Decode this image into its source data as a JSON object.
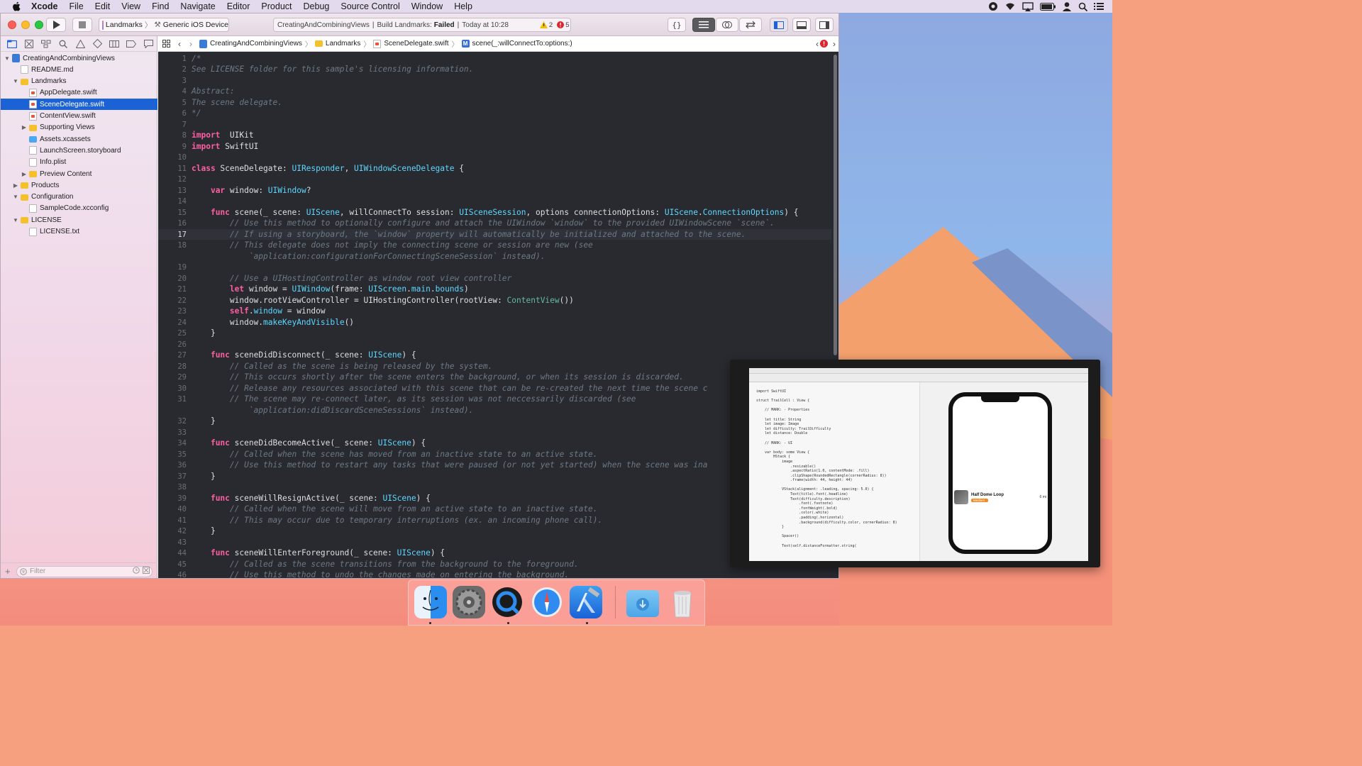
{
  "menubar": {
    "app": "Xcode",
    "items": [
      "File",
      "Edit",
      "View",
      "Find",
      "Navigate",
      "Editor",
      "Product",
      "Debug",
      "Source Control",
      "Window",
      "Help"
    ],
    "status_icons": [
      "creative-cloud-icon",
      "wifi-icon",
      "airplay-icon",
      "battery-icon",
      "user-icon",
      "spotlight-icon",
      "notification-center-icon"
    ]
  },
  "toolbar": {
    "scheme_target": "Landmarks",
    "scheme_device": "Generic iOS Device",
    "activity_project": "CreatingAndCombiningViews",
    "activity_status_prefix": "Build Landmarks:",
    "activity_status": "Failed",
    "activity_time": "Today at 10:28",
    "warnings": "2",
    "errors": "5"
  },
  "navigator": {
    "filter_placeholder": "Filter",
    "tree": [
      {
        "label": "CreatingAndCombiningViews",
        "kind": "proj",
        "depth": 0,
        "disclosure": "open"
      },
      {
        "label": "README.md",
        "kind": "file",
        "depth": 1,
        "disclosure": ""
      },
      {
        "label": "Landmarks",
        "kind": "folder",
        "depth": 1,
        "disclosure": "open"
      },
      {
        "label": "AppDelegate.swift",
        "kind": "swift",
        "depth": 2,
        "disclosure": ""
      },
      {
        "label": "SceneDelegate.swift",
        "kind": "swift",
        "depth": 2,
        "disclosure": "",
        "selected": true
      },
      {
        "label": "ContentView.swift",
        "kind": "swift",
        "depth": 2,
        "disclosure": ""
      },
      {
        "label": "Supporting Views",
        "kind": "folder",
        "depth": 2,
        "disclosure": "closed"
      },
      {
        "label": "Assets.xcassets",
        "kind": "assets",
        "depth": 2,
        "disclosure": ""
      },
      {
        "label": "LaunchScreen.storyboard",
        "kind": "file",
        "depth": 2,
        "disclosure": ""
      },
      {
        "label": "Info.plist",
        "kind": "file",
        "depth": 2,
        "disclosure": ""
      },
      {
        "label": "Preview Content",
        "kind": "folder",
        "depth": 2,
        "disclosure": "closed"
      },
      {
        "label": "Products",
        "kind": "folder",
        "depth": 1,
        "disclosure": "closed"
      },
      {
        "label": "Configuration",
        "kind": "folder",
        "depth": 1,
        "disclosure": "open"
      },
      {
        "label": "SampleCode.xcconfig",
        "kind": "file",
        "depth": 2,
        "disclosure": ""
      },
      {
        "label": "LICENSE",
        "kind": "folder",
        "depth": 1,
        "disclosure": "open"
      },
      {
        "label": "LICENSE.txt",
        "kind": "file",
        "depth": 2,
        "disclosure": ""
      }
    ]
  },
  "jumpbar": {
    "segments": [
      "CreatingAndCombiningViews",
      "Landmarks",
      "SceneDelegate.swift",
      "scene(_:willConnectTo:options:)"
    ]
  },
  "editor": {
    "current_line": "17",
    "lines": [
      {
        "n": "1",
        "tokens": [
          [
            "c",
            "/*"
          ]
        ]
      },
      {
        "n": "2",
        "tokens": [
          [
            "c",
            "See LICENSE folder for this sample's licensing information."
          ]
        ]
      },
      {
        "n": "3",
        "tokens": []
      },
      {
        "n": "4",
        "tokens": [
          [
            "c",
            "Abstract:"
          ]
        ]
      },
      {
        "n": "5",
        "tokens": [
          [
            "c",
            "The scene delegate."
          ]
        ]
      },
      {
        "n": "6",
        "tokens": [
          [
            "c",
            "*/"
          ]
        ]
      },
      {
        "n": "7",
        "tokens": []
      },
      {
        "n": "8",
        "tokens": [
          [
            "k",
            "import"
          ],
          [
            "",
            "  UIKit"
          ]
        ]
      },
      {
        "n": "9",
        "tokens": [
          [
            "k",
            "import"
          ],
          [
            "",
            " SwiftUI"
          ]
        ]
      },
      {
        "n": "10",
        "tokens": []
      },
      {
        "n": "11",
        "tokens": [
          [
            "k",
            "class"
          ],
          [
            "",
            " SceneDelegate: "
          ],
          [
            "t",
            "UIResponder"
          ],
          [
            "",
            ", "
          ],
          [
            "t",
            "UIWindowSceneDelegate"
          ],
          [
            "",
            " {"
          ]
        ]
      },
      {
        "n": "12",
        "tokens": []
      },
      {
        "n": "13",
        "tokens": [
          [
            "",
            "    "
          ],
          [
            "k",
            "var"
          ],
          [
            "",
            " window: "
          ],
          [
            "t",
            "UIWindow"
          ],
          [
            "",
            "?"
          ]
        ]
      },
      {
        "n": "14",
        "tokens": []
      },
      {
        "n": "15",
        "tokens": [
          [
            "",
            "    "
          ],
          [
            "k",
            "func"
          ],
          [
            "",
            " scene(_ scene: "
          ],
          [
            "t",
            "UIScene"
          ],
          [
            "",
            ", willConnectTo session: "
          ],
          [
            "t",
            "UISceneSession"
          ],
          [
            "",
            ", options connectionOptions: "
          ],
          [
            "t",
            "UIScene"
          ],
          [
            "",
            "."
          ],
          [
            "t",
            "ConnectionOptions"
          ],
          [
            "",
            ") {"
          ]
        ]
      },
      {
        "n": "16",
        "tokens": [
          [
            "",
            "        "
          ],
          [
            "c",
            "// Use this method to optionally configure and attach the UIWindow `window` to the provided UIWindowScene `scene`."
          ]
        ]
      },
      {
        "n": "17",
        "tokens": [
          [
            "",
            "        "
          ],
          [
            "c",
            "// If using a storyboard, the `window` property will automatically be initialized and attached to the scene."
          ]
        ]
      },
      {
        "n": "18",
        "tokens": [
          [
            "",
            "        "
          ],
          [
            "c",
            "// This delegate does not imply the connecting scene or session are new (see"
          ]
        ]
      },
      {
        "n": "",
        "tokens": [
          [
            "",
            "            "
          ],
          [
            "c",
            "`application:configurationForConnectingSceneSession` instead)."
          ]
        ]
      },
      {
        "n": "19",
        "tokens": []
      },
      {
        "n": "20",
        "tokens": [
          [
            "",
            "        "
          ],
          [
            "c",
            "// Use a UIHostingController as window root view controller"
          ]
        ]
      },
      {
        "n": "21",
        "tokens": [
          [
            "",
            "        "
          ],
          [
            "k",
            "let"
          ],
          [
            "",
            " window = "
          ],
          [
            "t",
            "UIWindow"
          ],
          [
            "",
            "(frame: "
          ],
          [
            "t",
            "UIScreen"
          ],
          [
            "",
            "."
          ],
          [
            "t",
            "main"
          ],
          [
            "",
            "."
          ],
          [
            "t",
            "bounds"
          ],
          [
            "",
            ")"
          ]
        ]
      },
      {
        "n": "22",
        "tokens": [
          [
            "",
            "        window.rootViewController = UIHostingController(rootView: "
          ],
          [
            "p",
            "ContentView"
          ],
          [
            "",
            "())"
          ]
        ]
      },
      {
        "n": "23",
        "tokens": [
          [
            "",
            "        "
          ],
          [
            "k",
            "self"
          ],
          [
            "",
            "."
          ],
          [
            "t",
            "window"
          ],
          [
            "",
            " = window"
          ]
        ]
      },
      {
        "n": "24",
        "tokens": [
          [
            "",
            "        window."
          ],
          [
            "t",
            "makeKeyAndVisible"
          ],
          [
            "",
            "()"
          ]
        ]
      },
      {
        "n": "25",
        "tokens": [
          [
            "",
            "    }"
          ]
        ]
      },
      {
        "n": "26",
        "tokens": []
      },
      {
        "n": "27",
        "tokens": [
          [
            "",
            "    "
          ],
          [
            "k",
            "func"
          ],
          [
            "",
            " sceneDidDisconnect(_ scene: "
          ],
          [
            "t",
            "UIScene"
          ],
          [
            "",
            ") {"
          ]
        ]
      },
      {
        "n": "28",
        "tokens": [
          [
            "",
            "        "
          ],
          [
            "c",
            "// Called as the scene is being released by the system."
          ]
        ]
      },
      {
        "n": "29",
        "tokens": [
          [
            "",
            "        "
          ],
          [
            "c",
            "// This occurs shortly after the scene enters the background, or when its session is discarded."
          ]
        ]
      },
      {
        "n": "30",
        "tokens": [
          [
            "",
            "        "
          ],
          [
            "c",
            "// Release any resources associated with this scene that can be re-created the next time the scene c"
          ]
        ]
      },
      {
        "n": "31",
        "tokens": [
          [
            "",
            "        "
          ],
          [
            "c",
            "// The scene may re-connect later, as its session was not neccessarily discarded (see"
          ]
        ]
      },
      {
        "n": "",
        "tokens": [
          [
            "",
            "            "
          ],
          [
            "c",
            "`application:didDiscardSceneSessions` instead)."
          ]
        ]
      },
      {
        "n": "32",
        "tokens": [
          [
            "",
            "    }"
          ]
        ]
      },
      {
        "n": "33",
        "tokens": []
      },
      {
        "n": "34",
        "tokens": [
          [
            "",
            "    "
          ],
          [
            "k",
            "func"
          ],
          [
            "",
            " sceneDidBecomeActive(_ scene: "
          ],
          [
            "t",
            "UIScene"
          ],
          [
            "",
            ") {"
          ]
        ]
      },
      {
        "n": "35",
        "tokens": [
          [
            "",
            "        "
          ],
          [
            "c",
            "// Called when the scene has moved from an inactive state to an active state."
          ]
        ]
      },
      {
        "n": "36",
        "tokens": [
          [
            "",
            "        "
          ],
          [
            "c",
            "// Use this method to restart any tasks that were paused (or not yet started) when the scene was ina"
          ]
        ]
      },
      {
        "n": "37",
        "tokens": [
          [
            "",
            "    }"
          ]
        ]
      },
      {
        "n": "38",
        "tokens": []
      },
      {
        "n": "39",
        "tokens": [
          [
            "",
            "    "
          ],
          [
            "k",
            "func"
          ],
          [
            "",
            " sceneWillResignActive(_ scene: "
          ],
          [
            "t",
            "UIScene"
          ],
          [
            "",
            ") {"
          ]
        ]
      },
      {
        "n": "40",
        "tokens": [
          [
            "",
            "        "
          ],
          [
            "c",
            "// Called when the scene will move from an active state to an inactive state."
          ]
        ]
      },
      {
        "n": "41",
        "tokens": [
          [
            "",
            "        "
          ],
          [
            "c",
            "// This may occur due to temporary interruptions (ex. an incoming phone call)."
          ]
        ]
      },
      {
        "n": "42",
        "tokens": [
          [
            "",
            "    }"
          ]
        ]
      },
      {
        "n": "43",
        "tokens": []
      },
      {
        "n": "44",
        "tokens": [
          [
            "",
            "    "
          ],
          [
            "k",
            "func"
          ],
          [
            "",
            " sceneWillEnterForeground(_ scene: "
          ],
          [
            "t",
            "UIScene"
          ],
          [
            "",
            ") {"
          ]
        ]
      },
      {
        "n": "45",
        "tokens": [
          [
            "",
            "        "
          ],
          [
            "c",
            "// Called as the scene transitions from the background to the foreground."
          ]
        ]
      },
      {
        "n": "46",
        "tokens": [
          [
            "",
            "        "
          ],
          [
            "c",
            "// Use this method to undo the changes made on entering the background."
          ]
        ]
      }
    ]
  },
  "pip": {
    "code_lines": [
      "import SwiftUI",
      "",
      "struct TrailCell : View {",
      "",
      "    // MARK: - Properties",
      "",
      "    let title: String",
      "    let image: Image",
      "    let difficulty: TrailDifficulty",
      "    let distance: Double",
      "",
      "    // MARK: - UI",
      "",
      "    var body: some View {",
      "        HStack {",
      "            image",
      "                .resizable()",
      "                .aspectRatio(1.0, contentMode: .fill)",
      "                .clipShape(RoundedRectangle(cornerRadius: 8))",
      "                .frame(width: 44, height: 44)",
      "",
      "            VStack(alignment: .leading, spacing: 5.0) {",
      "                Text(title).font(.headline)",
      "                Text(difficulty.description)",
      "                    .font(.footnote)",
      "                    .fontWeight(.bold)",
      "                    .color(.white)",
      "                    .padding(.horizontal)",
      "                    .background(difficulty.color, cornerRadius: 8)",
      "            }",
      "",
      "            Spacer()",
      "",
      "            Text(self.distanceFormatter.string("
    ],
    "preview_title": "Half Dome Loop",
    "preview_badge": "Medium",
    "preview_distance": "6 mi"
  },
  "dock": {
    "apps": [
      "finder-icon",
      "system-preferences-icon",
      "quicktime-icon",
      "safari-icon",
      "xcode-icon",
      "downloads-folder-icon",
      "trash-icon"
    ]
  }
}
